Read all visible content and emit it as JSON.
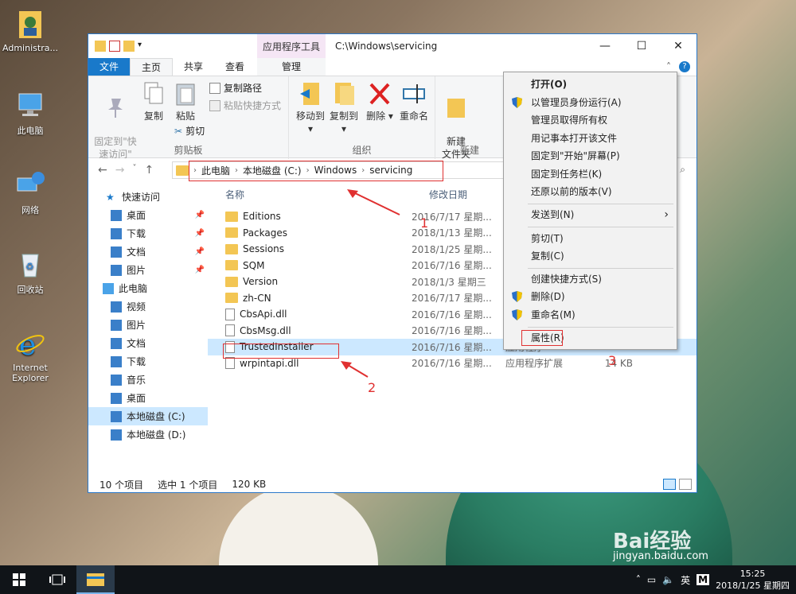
{
  "desktop": {
    "icons": [
      {
        "label": "Administra..."
      },
      {
        "label": "此电脑"
      },
      {
        "label": "网络"
      },
      {
        "label": "回收站"
      },
      {
        "label": "Internet Explorer"
      }
    ],
    "watermark": "Bai经验",
    "watermark_url": "jingyan.baidu.com"
  },
  "window": {
    "contextual_tab_title": "应用程序工具",
    "path_title": "C:\\Windows\\servicing",
    "controls": {
      "minimize": "—",
      "maximize": "☐",
      "close": "✕"
    }
  },
  "tabs": [
    "文件",
    "主页",
    "共享",
    "查看"
  ],
  "manage_tab": "管理",
  "ribbon": {
    "pin_quick_access": "固定到\"快\n速访问\"",
    "copy": "复制",
    "paste": "粘贴",
    "copy_path": "复制路径",
    "paste_shortcut": "粘贴快捷方式",
    "cut": "剪切",
    "clipboard_group": "剪贴板",
    "move_to": "移动到",
    "copy_to": "复制到",
    "delete": "删除",
    "rename": "重命名",
    "organize_group": "组织",
    "new_folder": "新建\n文件夹",
    "new_group": "新建"
  },
  "address": {
    "segments": [
      "此电脑",
      "本地磁盘 (C:)",
      "Windows",
      "servicing"
    ]
  },
  "nav": {
    "items": [
      {
        "label": "快速访问",
        "pinned": false
      },
      {
        "label": "桌面",
        "pinned": true
      },
      {
        "label": "下载",
        "pinned": true
      },
      {
        "label": "文档",
        "pinned": true
      },
      {
        "label": "图片",
        "pinned": true
      },
      {
        "label": "此电脑",
        "pinned": false
      },
      {
        "label": "视频",
        "pinned": false
      },
      {
        "label": "图片",
        "pinned": false
      },
      {
        "label": "文档",
        "pinned": false
      },
      {
        "label": "下载",
        "pinned": false
      },
      {
        "label": "音乐",
        "pinned": false
      },
      {
        "label": "桌面",
        "pinned": false
      },
      {
        "label": "本地磁盘 (C:)",
        "pinned": false
      },
      {
        "label": "本地磁盘 (D:)",
        "pinned": false
      }
    ]
  },
  "columns": {
    "name": "名称",
    "date": "修改日期"
  },
  "files": [
    {
      "name": "Editions",
      "date": "2016/7/17 星期...",
      "type": "",
      "size": "",
      "kind": "folder"
    },
    {
      "name": "Packages",
      "date": "2018/1/13 星期...",
      "type": "",
      "size": "",
      "kind": "folder"
    },
    {
      "name": "Sessions",
      "date": "2018/1/25 星期...",
      "type": "",
      "size": "",
      "kind": "folder"
    },
    {
      "name": "SQM",
      "date": "2016/7/16 星期...",
      "type": "",
      "size": "",
      "kind": "folder"
    },
    {
      "name": "Version",
      "date": "2018/1/3 星期三",
      "type": "",
      "size": "",
      "kind": "folder"
    },
    {
      "name": "zh-CN",
      "date": "2016/7/17 星期...",
      "type": "",
      "size": "",
      "kind": "folder"
    },
    {
      "name": "CbsApi.dll",
      "date": "2016/7/16 星期...",
      "type": "",
      "size": "",
      "kind": "file"
    },
    {
      "name": "CbsMsg.dll",
      "date": "2016/7/16 星期...",
      "type": "",
      "size": "",
      "kind": "file"
    },
    {
      "name": "TrustedInstaller",
      "date": "2016/7/16 星期...",
      "type": "应用程序",
      "size": "120 KB",
      "kind": "exe"
    },
    {
      "name": "wrpintapi.dll",
      "date": "2016/7/16 星期...",
      "type": "应用程序扩展",
      "size": "14 KB",
      "kind": "file"
    }
  ],
  "status": {
    "count": "10 个项目",
    "selected": "选中 1 个项目",
    "size": "120 KB"
  },
  "context_menu": {
    "open": "打开(O)",
    "run_as_admin": "以管理员身份运行(A)",
    "take_ownership": "管理员取得所有权",
    "open_notepad": "用记事本打开该文件",
    "pin_start": "固定到\"开始\"屏幕(P)",
    "pin_taskbar": "固定到任务栏(K)",
    "restore": "还原以前的版本(V)",
    "send_to": "发送到(N)",
    "cut": "剪切(T)",
    "copy": "复制(C)",
    "create_shortcut": "创建快捷方式(S)",
    "delete": "删除(D)",
    "rename": "重命名(M)",
    "properties": "属性(R)"
  },
  "annotations": {
    "one": "1",
    "two": "2",
    "three": "3"
  },
  "taskbar": {
    "ime": "英",
    "time": "15:25",
    "date": "2018/1/25 星期四"
  },
  "colors": {
    "accent": "#1979ca",
    "selection": "#cce8ff",
    "annotation": "#e03030"
  }
}
